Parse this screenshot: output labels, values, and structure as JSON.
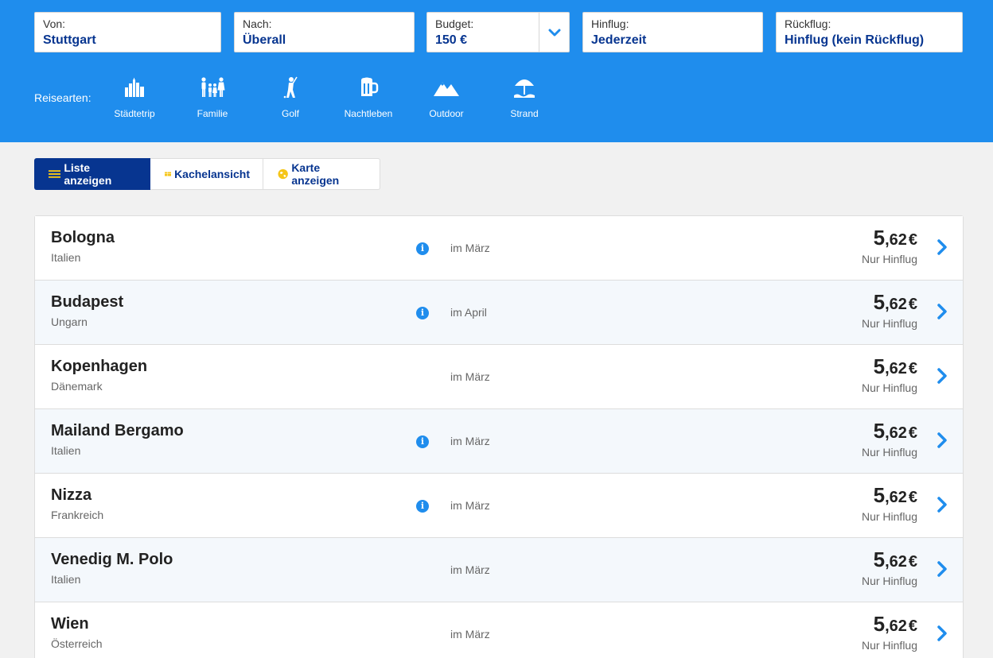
{
  "colors": {
    "brand_blue": "#1f8ded",
    "navy": "#073590",
    "accent_yellow": "#f5c518"
  },
  "search": {
    "von": {
      "label": "Von:",
      "value": "Stuttgart"
    },
    "nach": {
      "label": "Nach:",
      "value": "Überall"
    },
    "budget": {
      "label": "Budget:",
      "value": "150 €"
    },
    "hinflug": {
      "label": "Hinflug:",
      "value": "Jederzeit"
    },
    "rueckflug": {
      "label": "Rückflug:",
      "value": "Hinflug (kein Rückflug)"
    }
  },
  "reisearten": {
    "label": "Reisearten:",
    "items": [
      {
        "label": "Städtetrip",
        "icon": "city-skyline-icon"
      },
      {
        "label": "Familie",
        "icon": "family-icon"
      },
      {
        "label": "Golf",
        "icon": "golfer-icon"
      },
      {
        "label": "Nachtleben",
        "icon": "beer-mug-icon"
      },
      {
        "label": "Outdoor",
        "icon": "mountain-icon"
      },
      {
        "label": "Strand",
        "icon": "beach-umbrella-icon"
      }
    ]
  },
  "views": {
    "list": "Liste anzeigen",
    "tiles": "Kachelansicht",
    "map": "Karte anzeigen"
  },
  "results": [
    {
      "city": "Bologna",
      "country": "Italien",
      "info": true,
      "month": "im März",
      "price_int": "5",
      "price_dec": ",62",
      "currency": "€",
      "note": "Nur Hinflug"
    },
    {
      "city": "Budapest",
      "country": "Ungarn",
      "info": true,
      "month": "im April",
      "price_int": "5",
      "price_dec": ",62",
      "currency": "€",
      "note": "Nur Hinflug"
    },
    {
      "city": "Kopenhagen",
      "country": "Dänemark",
      "info": false,
      "month": "im März",
      "price_int": "5",
      "price_dec": ",62",
      "currency": "€",
      "note": "Nur Hinflug"
    },
    {
      "city": "Mailand Bergamo",
      "country": "Italien",
      "info": true,
      "month": "im März",
      "price_int": "5",
      "price_dec": ",62",
      "currency": "€",
      "note": "Nur Hinflug"
    },
    {
      "city": "Nizza",
      "country": "Frankreich",
      "info": true,
      "month": "im März",
      "price_int": "5",
      "price_dec": ",62",
      "currency": "€",
      "note": "Nur Hinflug"
    },
    {
      "city": "Venedig M. Polo",
      "country": "Italien",
      "info": false,
      "month": "im März",
      "price_int": "5",
      "price_dec": ",62",
      "currency": "€",
      "note": "Nur Hinflug"
    },
    {
      "city": "Wien",
      "country": "Österreich",
      "info": false,
      "month": "im März",
      "price_int": "5",
      "price_dec": ",62",
      "currency": "€",
      "note": "Nur Hinflug"
    }
  ]
}
